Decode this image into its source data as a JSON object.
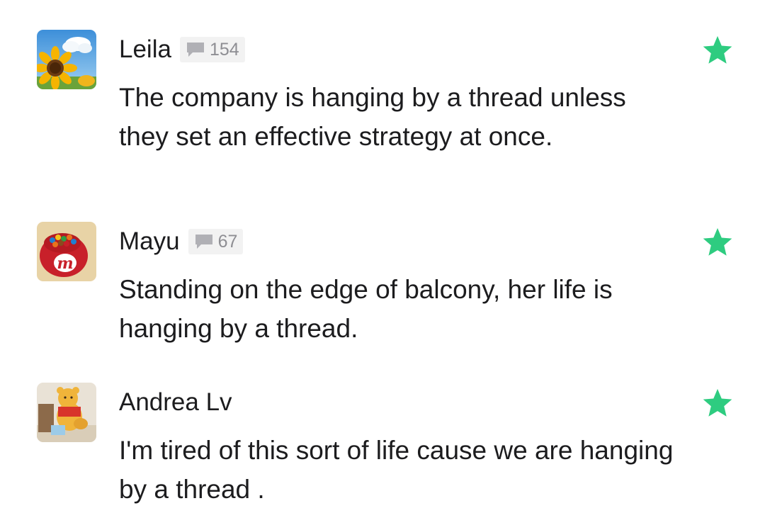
{
  "comments": [
    {
      "author": "Leila",
      "comment_count": "154",
      "text": "The company is hanging by a thread unless they set an effective strategy at once.",
      "avatar_icon": "sunflower-avatar-icon",
      "starred": true
    },
    {
      "author": "Mayu",
      "comment_count": "67",
      "text": "Standing on the edge of balcony, her life is hanging by a thread.",
      "avatar_icon": "mm-candy-avatar-icon",
      "starred": true
    },
    {
      "author": "Andrea Lv",
      "comment_count": "",
      "text": "I'm tired of this sort of life cause we are hanging by a thread .",
      "avatar_icon": "winnie-bear-avatar-icon",
      "starred": true
    }
  ],
  "colors": {
    "star": "#2ecc80",
    "badge_bg": "#f2f2f2",
    "badge_text": "#8e8e93",
    "text": "#1c1c1e"
  }
}
